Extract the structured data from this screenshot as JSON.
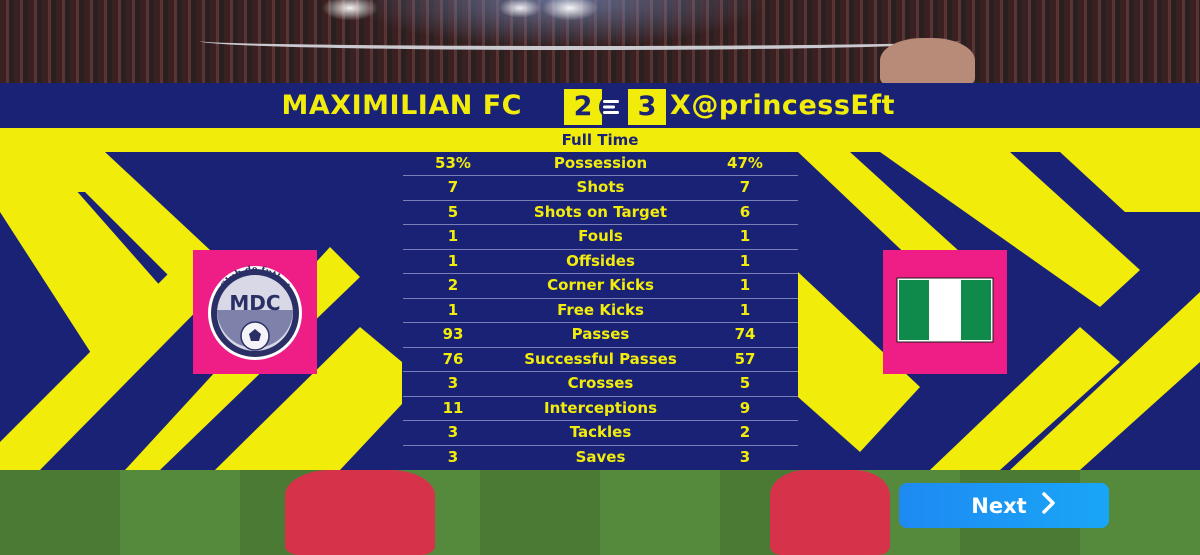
{
  "match": {
    "home_team": "MAXIMILIAN FC",
    "away_team": "X@princessEft",
    "home_score": "2",
    "away_score": "3",
    "status": "Full Time"
  },
  "home_badge": {
    "text_top": "Club de futbol",
    "initials": "MDC"
  },
  "stats": [
    {
      "label": "Possession",
      "home": "53%",
      "away": "47%"
    },
    {
      "label": "Shots",
      "home": "7",
      "away": "7"
    },
    {
      "label": "Shots on Target",
      "home": "5",
      "away": "6"
    },
    {
      "label": "Fouls",
      "home": "1",
      "away": "1"
    },
    {
      "label": "Offsides",
      "home": "1",
      "away": "1"
    },
    {
      "label": "Corner Kicks",
      "home": "2",
      "away": "1"
    },
    {
      "label": "Free Kicks",
      "home": "1",
      "away": "1"
    },
    {
      "label": "Passes",
      "home": "93",
      "away": "74"
    },
    {
      "label": "Successful Passes",
      "home": "76",
      "away": "57"
    },
    {
      "label": "Crosses",
      "home": "3",
      "away": "5"
    },
    {
      "label": "Interceptions",
      "home": "11",
      "away": "9"
    },
    {
      "label": "Tackles",
      "home": "3",
      "away": "2"
    },
    {
      "label": "Saves",
      "home": "3",
      "away": "3"
    }
  ],
  "next_button": {
    "label": "Next"
  },
  "icons": {
    "league_logo": "efootball-logo-icon",
    "next": "chevron-right-icon",
    "away_flag": "nigeria-flag-icon"
  },
  "colors": {
    "panel_navy": "#1a2276",
    "accent_yellow": "#f2ec0b",
    "badge_pink": "#ee1e86",
    "button_blue": "#1e8af2",
    "flag_green": "#0f8a4a"
  }
}
